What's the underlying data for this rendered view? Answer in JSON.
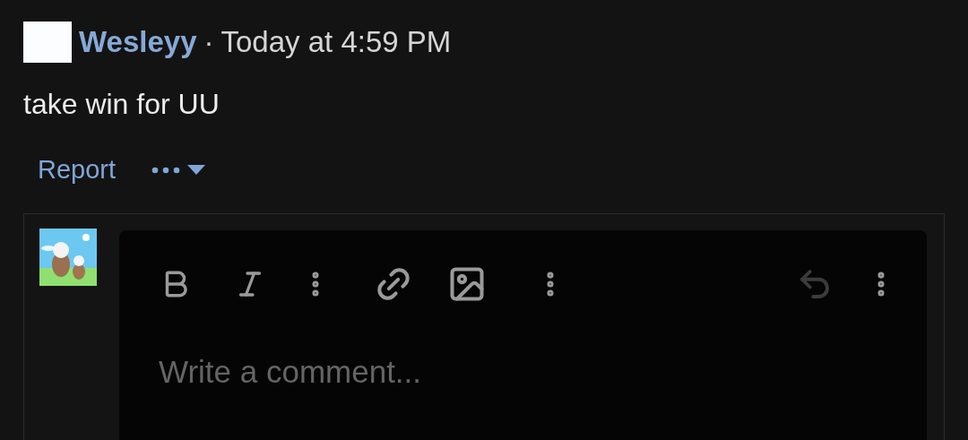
{
  "post": {
    "author": "Wesleyy",
    "separator": "·",
    "time": "Today at 4:59 PM",
    "body": "take win for UU",
    "actions": {
      "report": "Report"
    }
  },
  "comment_editor": {
    "toolbar": {
      "undo_disabled": true
    },
    "placeholder": "Write a comment..."
  }
}
